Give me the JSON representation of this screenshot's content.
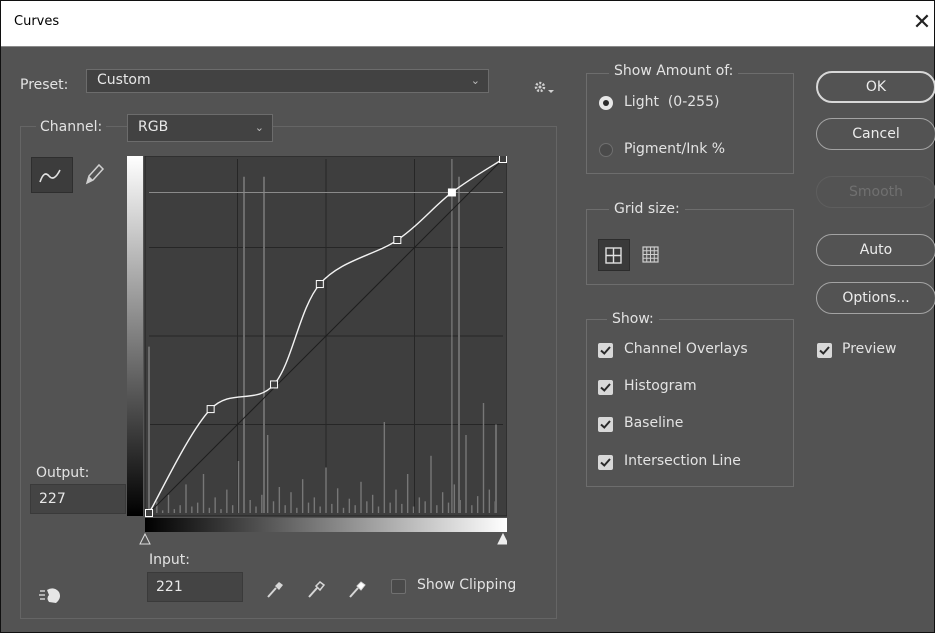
{
  "window": {
    "title": "Curves",
    "close_glyph": "✕"
  },
  "preset": {
    "label": "Preset:",
    "value": "Custom",
    "gear_icon": "gear-icon"
  },
  "channel": {
    "label": "Channel:",
    "value": "RGB"
  },
  "tools": {
    "curve": "curve-tool-icon",
    "pencil": "pencil-icon"
  },
  "output": {
    "label": "Output:",
    "value": "227"
  },
  "input": {
    "label": "Input:",
    "value": "221"
  },
  "show_clipping": {
    "label": "Show Clipping",
    "checked": false
  },
  "eyedroppers": [
    "black-point-eyedropper-icon",
    "gray-point-eyedropper-icon",
    "white-point-eyedropper-icon"
  ],
  "targeted_adjust_icon": "targeted-adjustment-hand-icon",
  "show_amount": {
    "title": "Show Amount of:",
    "options": [
      {
        "label": "Light  (0-255)",
        "selected": true
      },
      {
        "label": "Pigment/Ink %",
        "selected": false
      }
    ]
  },
  "grid_size": {
    "title": "Grid size:",
    "options": [
      "simple-grid-icon",
      "detailed-grid-icon"
    ],
    "selected": 0
  },
  "show": {
    "title": "Show:",
    "items": [
      {
        "label": "Channel Overlays",
        "checked": true
      },
      {
        "label": "Histogram",
        "checked": true
      },
      {
        "label": "Baseline",
        "checked": true
      },
      {
        "label": "Intersection Line",
        "checked": true
      }
    ]
  },
  "buttons": {
    "ok": "OK",
    "cancel": "Cancel",
    "smooth": "Smooth",
    "auto": "Auto",
    "options": "Options..."
  },
  "preview": {
    "label": "Preview",
    "checked": true
  },
  "curve": {
    "points": [
      [
        0,
        0
      ],
      [
        35,
        59
      ],
      [
        71,
        73
      ],
      [
        97,
        130
      ],
      [
        141,
        155
      ],
      [
        172,
        182
      ],
      [
        201,
        201
      ]
    ],
    "selected_point": 5,
    "range": [
      0,
      201
    ]
  },
  "colors": {
    "dialog_bg": "#535353",
    "graph_bg": "#3e3e3e",
    "curve": "#f2f2f2"
  }
}
